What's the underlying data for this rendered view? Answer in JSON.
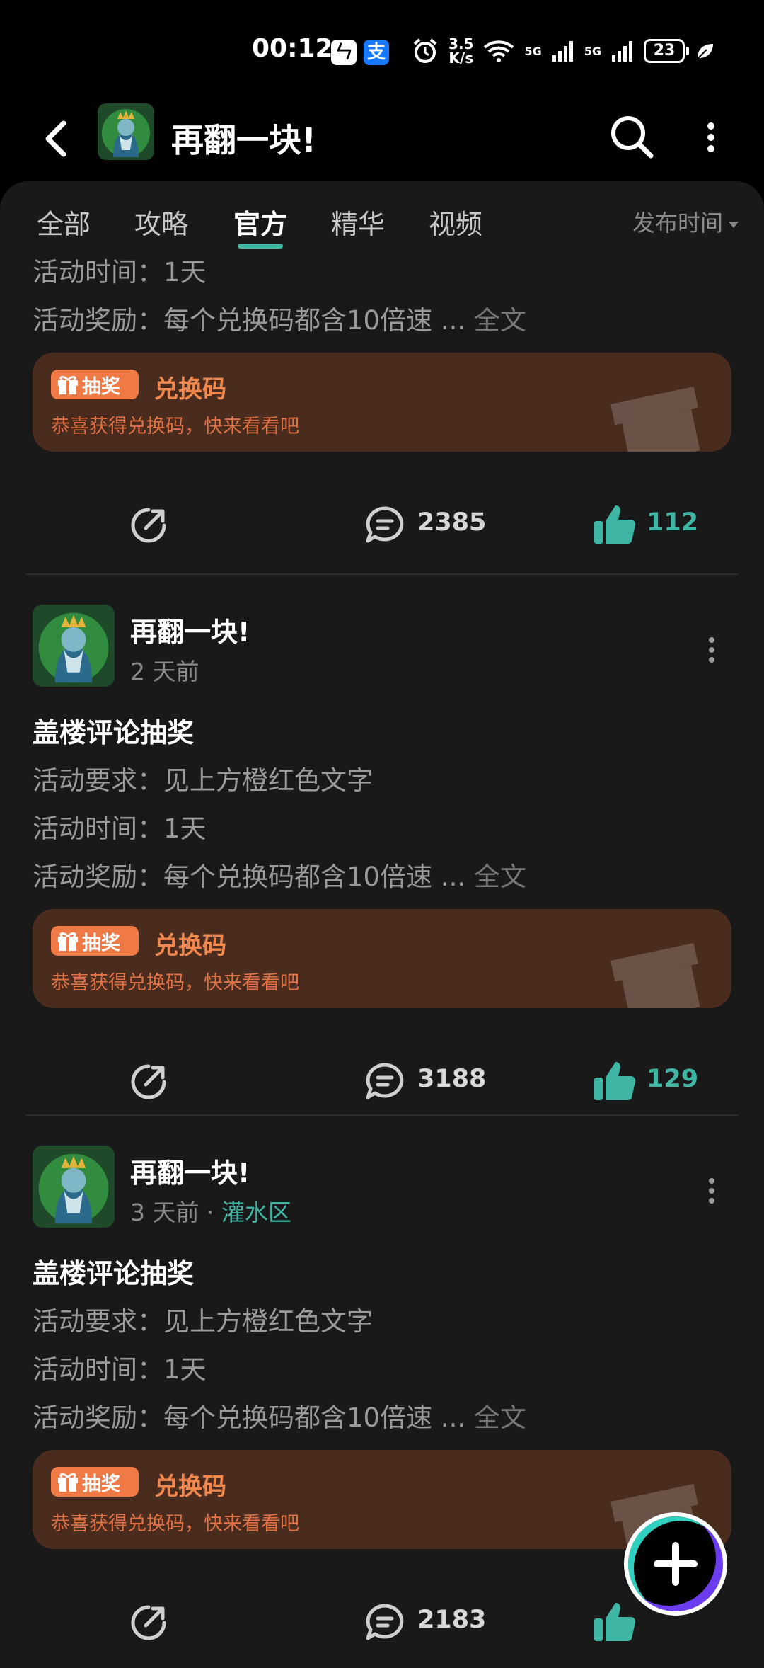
{
  "status_bar": {
    "time": "00:12",
    "net_speed_value": "3.5",
    "net_speed_unit": "K/s",
    "signal_label_1": "5G",
    "signal_label_2": "5G",
    "battery": "23"
  },
  "header": {
    "title": "再翻一块!",
    "back_icon": "chevron-left-icon",
    "search_icon": "search-icon",
    "more_icon": "more-vertical-icon"
  },
  "tabs": [
    {
      "label": "全部",
      "active": false
    },
    {
      "label": "攻略",
      "active": false
    },
    {
      "label": "官方",
      "active": true
    },
    {
      "label": "精华",
      "active": false
    },
    {
      "label": "视频",
      "active": false
    }
  ],
  "sort_label": "发布时间",
  "posts": [
    {
      "lines": [
        {
          "text": "活动时间：1天"
        },
        {
          "text": "活动奖励：每个兑换码都含10倍速 ...",
          "more": "全文"
        }
      ],
      "card": {
        "badge": "抽奖",
        "title": "兑换码",
        "subtitle": "恭喜获得兑换码，快来看看吧"
      },
      "comments": "2385",
      "likes": "112"
    },
    {
      "author": "再翻一块!",
      "time": "2 天前",
      "title": "盖楼评论抽奖",
      "lines": [
        {
          "text": "活动要求：见上方橙红色文字"
        },
        {
          "text": "活动时间：1天"
        },
        {
          "text": "活动奖励：每个兑换码都含10倍速 ...",
          "more": "全文"
        }
      ],
      "card": {
        "badge": "抽奖",
        "title": "兑换码",
        "subtitle": "恭喜获得兑换码，快来看看吧"
      },
      "comments": "3188",
      "likes": "129"
    },
    {
      "author": "再翻一块!",
      "time": "3 天前",
      "separator": "·",
      "category": "灌水区",
      "title": "盖楼评论抽奖",
      "lines": [
        {
          "text": "活动要求：见上方橙红色文字"
        },
        {
          "text": "活动时间：1天"
        },
        {
          "text": "活动奖励：每个兑换码都含10倍速 ...",
          "more": "全文"
        }
      ],
      "card": {
        "badge": "抽奖",
        "title": "兑换码",
        "subtitle": "恭喜获得兑换码，快来看看吧"
      },
      "comments": "2183"
    }
  ],
  "colors": {
    "accent": "#3fb6a4",
    "card_bg": "#4a2c1f",
    "badge": "#f07a45",
    "background": "#191919"
  }
}
